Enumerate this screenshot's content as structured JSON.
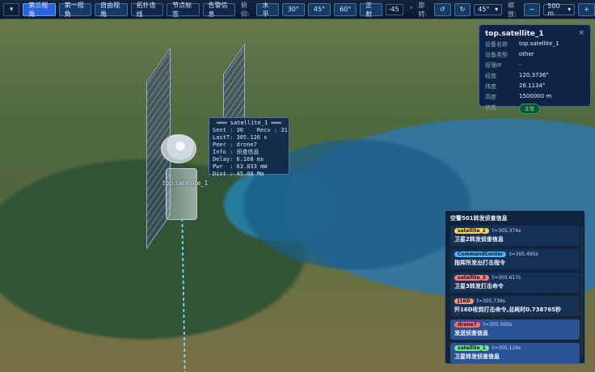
{
  "toolbar": {
    "dropdown_icon": "chevron-down",
    "views": [
      "第三视角",
      "第一视角",
      "自由视角"
    ],
    "buttons": [
      "拓扑连线",
      "节点标签",
      "告警信息"
    ],
    "pitch_label": "俯仰:",
    "pitch_buttons": [
      "水平",
      "30°",
      "45°",
      "60°",
      "正射"
    ],
    "pitch_value": "-45",
    "pitch_unit": "°",
    "rotate_label": "旋转:",
    "rotate_left": "↺",
    "rotate_right": "↻",
    "rotate_value": "45°",
    "zoom_label": "缩放:",
    "zoom_minus": "−",
    "zoom_value": "500 m",
    "zoom_plus": "+"
  },
  "scene": {
    "satellite_label": "top.satellite_1"
  },
  "terminal": {
    "title": "═══ satellite_1 ═══",
    "lines": [
      "Sent : 30    Recv : 31",
      "LastT: 305.126 s",
      "Peer : drone7",
      "Info : 侦查信息",
      "Delay: 6.168 ms",
      "Pwr  : 63.833 mW",
      "Dist : 45.08 Mm"
    ]
  },
  "info_card": {
    "title": "top.satellite_1",
    "close": "×",
    "fields": [
      {
        "k": "设备名称",
        "v": "top.satellite_1"
      },
      {
        "k": "设备类型",
        "v": "other"
      },
      {
        "k": "管理IP",
        "v": "-"
      },
      {
        "k": "经度",
        "v": "120.3736°"
      },
      {
        "k": "纬度",
        "v": "26.1134°"
      },
      {
        "k": "高度",
        "v": "1500000 m"
      },
      {
        "k": "状态",
        "v": "正常"
      }
    ]
  },
  "log": {
    "first": "空警501转发侦查信息",
    "items": [
      {
        "tag": "satellite_2",
        "tag_color": "#ffd54a",
        "time": "t=305.374s",
        "msg": "卫星2转发侦查信息"
      },
      {
        "tag": "CommandCenter",
        "tag_color": "#49b6ff",
        "time": "t=305.495s",
        "msg": "指挥所发出打击指令"
      },
      {
        "tag": "satellite_3",
        "tag_color": "#ff7a7a",
        "time": "t=305.617s",
        "msg": "卫星3转发打击命令"
      },
      {
        "tag": "J16D",
        "tag_color": "#ff8d7b",
        "time": "t=305.739s",
        "msg": "歼16D收到打击命令,总耗时0.738765秒"
      },
      {
        "tag": "drone7",
        "tag_color": "#ff6e6e",
        "time": "t=305.000s",
        "msg": "发送侦查信息"
      },
      {
        "tag": "satellite_1",
        "tag_color": "#77e28d",
        "time": "t=305.126s",
        "msg": "卫星转发侦查信息"
      }
    ]
  }
}
